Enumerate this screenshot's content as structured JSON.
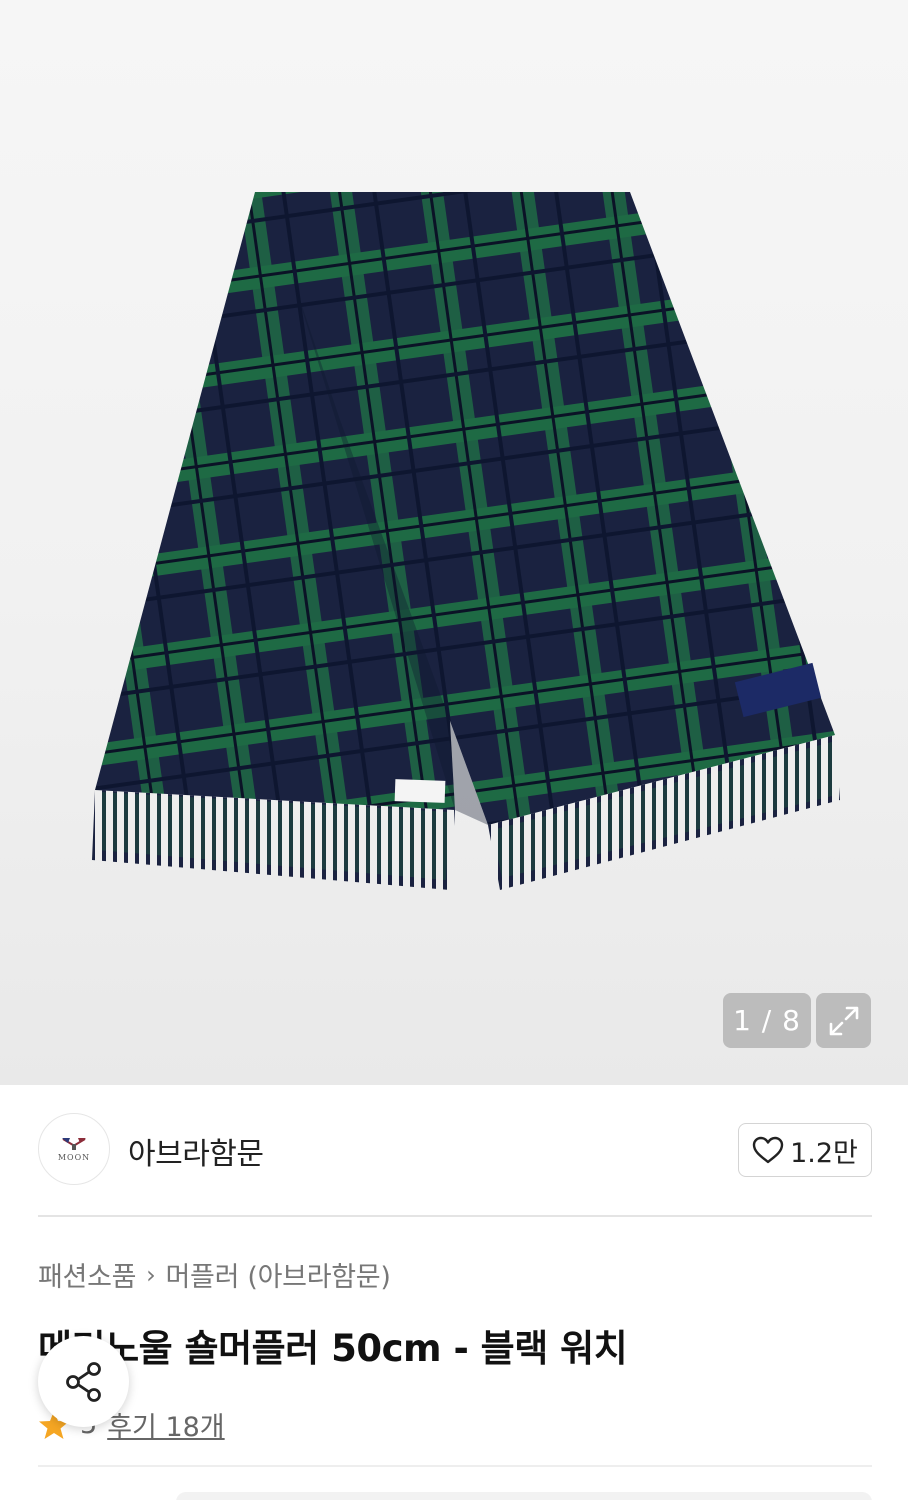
{
  "gallery": {
    "current_index": "1",
    "total": "8",
    "counter_text": "1 / 8",
    "colors": {
      "navy": "#1b2340",
      "green": "#1f6b45",
      "background": "#f2f2f2"
    }
  },
  "seller": {
    "name": "아브라함문",
    "logo_text": "MOON",
    "like_count": "1.2만"
  },
  "breadcrumb": {
    "items": [
      "패션소품",
      "머플러 (아브라함문)"
    ],
    "separator": "›"
  },
  "product": {
    "title": "메리노울 숄머플러 50cm - 블랙 워치",
    "rating": "5",
    "review_link": "후기 18개"
  },
  "icons": {
    "expand": "expand-icon",
    "heart": "heart-icon",
    "share": "share-icon",
    "star": "star-icon",
    "chevron": "chevron-right-icon"
  },
  "accent": {
    "star": "#f5a623"
  }
}
